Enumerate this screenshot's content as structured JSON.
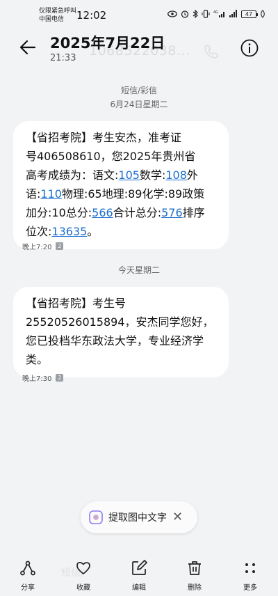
{
  "status": {
    "carrier_line1": "仅限紧急呼叫",
    "carrier_line2": "中国电信",
    "time": "12:02",
    "battery": "47"
  },
  "header": {
    "title": "2025年7月22日",
    "subtitle": "21:33",
    "behind_number": "1068522038..."
  },
  "thread": {
    "type_label": "短信/彩信",
    "messages": [
      {
        "date_label": "6月24日星期二",
        "lines": [
          [
            "【省招考院】考生安杰，准考证"
          ],
          [
            "号406508610，您2025年贵州省"
          ],
          [
            "高考成绩为：语文:",
            "105",
            "数学:",
            "108",
            "外"
          ],
          [
            "语:",
            "110",
            "物理:65地理:89化学:89政策"
          ],
          [
            "加分:10总分:",
            "566",
            "合计总分:",
            "576",
            "排序"
          ],
          [
            "位次:",
            "13635",
            "。"
          ]
        ],
        "time": "晚上7:20",
        "sim": "2"
      },
      {
        "date_label": "今天星期二",
        "lines": [
          [
            "【省招考院】考生号"
          ],
          [
            "25520526015894，安杰同学您好，"
          ],
          [
            "您已投档华东政法大学，专业经济学"
          ],
          [
            "类。"
          ]
        ],
        "time": "晚上7:30",
        "sim": "2"
      }
    ]
  },
  "ocr_popup": {
    "label": "提取图中文字",
    "close": "✕"
  },
  "compose_hint": "短信/",
  "toolbar": {
    "share": "分享",
    "favorite": "收藏",
    "edit": "编辑",
    "delete": "删除",
    "more": "更多"
  },
  "colors": {
    "background": "#f1f3f5",
    "bubble": "#ffffff",
    "link": "#1a6fcf"
  }
}
